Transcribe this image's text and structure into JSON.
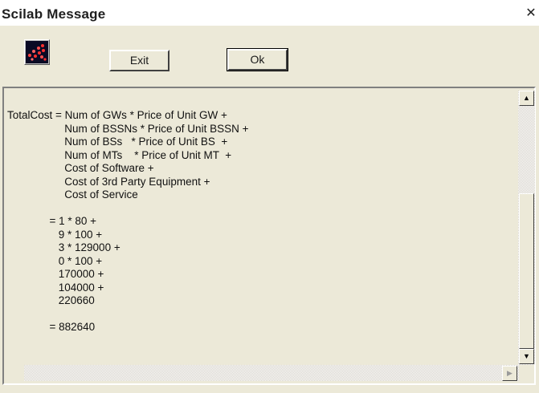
{
  "window": {
    "title": "Scilab Message",
    "close_glyph": "✕"
  },
  "icons": {
    "app": "scilab-logo-icon",
    "scroll_up": "arrow-up-icon",
    "scroll_down": "arrow-down-icon",
    "scroll_left": "arrow-left-icon",
    "scroll_right": "arrow-right-icon"
  },
  "buttons": {
    "exit_label": "Exit",
    "ok_label": "Ok"
  },
  "message": {
    "lines": [
      "TotalCost = Num of GWs * Price of Unit GW +",
      "                   Num of BSSNs * Price of Unit BSSN +",
      "                   Num of BSs   * Price of Unit BS  +",
      "                   Num of MTs    * Price of Unit MT  +",
      "                   Cost of Software +",
      "                   Cost of 3rd Party Equipment +",
      "                   Cost of Service",
      "",
      "              = 1 * 80 +",
      "                 9 * 100 +",
      "                 3 * 129000 +",
      "                 0 * 100 +",
      "                 170000 +",
      "                 104000 +",
      "                 220660",
      "",
      "              = 882640"
    ]
  },
  "scroll": {
    "vertical_position": 1.0,
    "horizontal_position": 0.0
  },
  "colors": {
    "face": "#ece9d8",
    "title_bg": "#ffffff",
    "text": "#111111"
  }
}
